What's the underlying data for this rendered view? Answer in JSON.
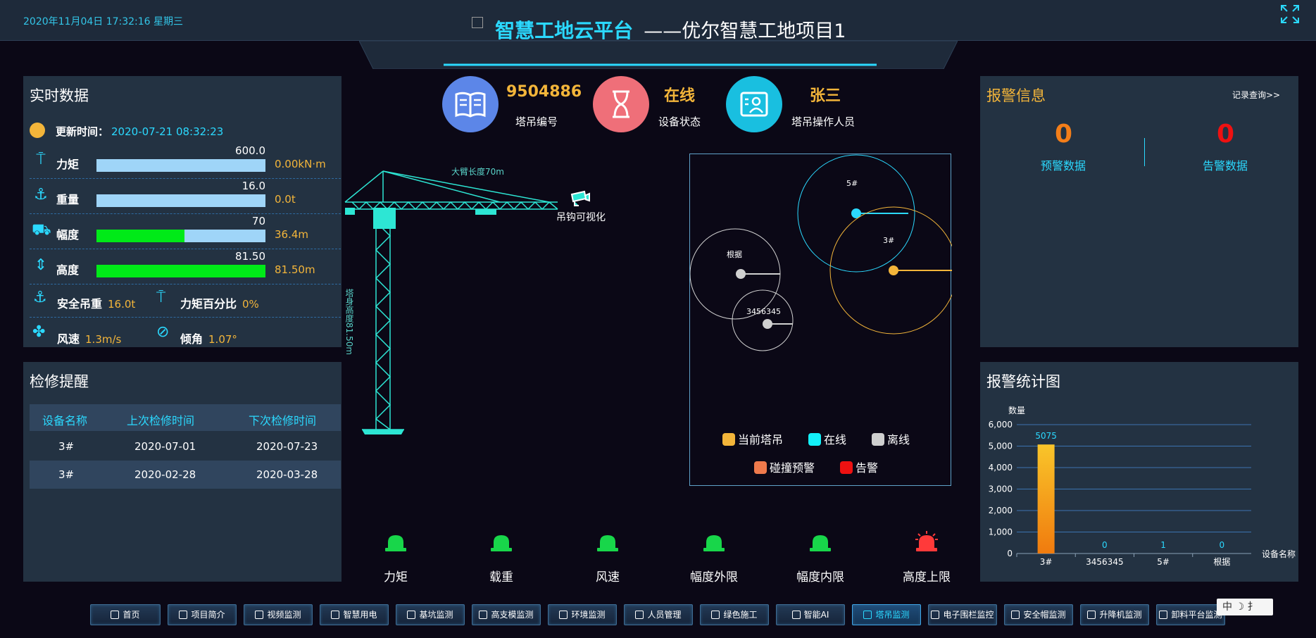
{
  "header": {
    "datetime": "2020年11月04日 17:32:16 星期三",
    "title_main": "智慧工地云平台",
    "title_sub": "——优尔智慧工地项目1"
  },
  "realtime": {
    "title": "实时数据",
    "update_label": "更新时间：",
    "update_time": "2020-07-21 08:32:23",
    "rows": [
      {
        "label": "力矩",
        "max": "600.0",
        "value": "0.00kN·m",
        "fill": 0.0,
        "icon": "crane-torque-icon"
      },
      {
        "label": "重量",
        "max": "16.0",
        "value": "0.0t",
        "fill": 0.0,
        "icon": "anchor-icon"
      },
      {
        "label": "幅度",
        "max": "70",
        "value": "36.4m",
        "fill": 0.52,
        "icon": "trolley-icon"
      },
      {
        "label": "高度",
        "max": "81.50",
        "value": "81.50m",
        "fill": 1.0,
        "icon": "height-icon"
      }
    ],
    "safe_load_label": "安全吊重",
    "safe_load_value": "16.0t",
    "torque_pct_label": "力矩百分比",
    "torque_pct_value": "0%",
    "wind_label": "风速",
    "wind_value": "1.3m/s",
    "tilt_label": "倾角",
    "tilt_value": "1.07°"
  },
  "maintenance": {
    "title": "检修提醒",
    "headers": [
      "设备名称",
      "上次检修时间",
      "下次检修时间"
    ],
    "rows": [
      [
        "3#",
        "2020-07-01",
        "2020-07-23"
      ],
      [
        "3#",
        "2020-02-28",
        "2020-03-28"
      ]
    ]
  },
  "stats": {
    "crane_id_value": "9504886",
    "crane_id_label": "塔吊编号",
    "status_value": "在线",
    "status_label": "设备状态",
    "operator_value": "张三",
    "operator_label": "塔吊操作人员"
  },
  "crane": {
    "arm_label": "大臂长度70m",
    "height_label": "塔身高度81.50m",
    "hook_label": "吊钩可视化"
  },
  "map": {
    "circles": [
      {
        "name": "5#",
        "color": "#2bd9ff"
      },
      {
        "name": "3#",
        "color": "#f3b53a"
      },
      {
        "name": "根据",
        "color": "#d0d0d0"
      },
      {
        "name": "3456345",
        "color": "#d0d0d0"
      }
    ],
    "legend": [
      {
        "label": "当前塔吊",
        "color": "#f3b53a"
      },
      {
        "label": "在线",
        "color": "#13f0f8"
      },
      {
        "label": "离线",
        "color": "#cfcfcf"
      },
      {
        "label": "碰撞预警",
        "color": "#ef7a4c"
      },
      {
        "label": "告警",
        "color": "#ee1111"
      }
    ]
  },
  "lights": [
    {
      "label": "力矩",
      "state": "green"
    },
    {
      "label": "载重",
      "state": "green"
    },
    {
      "label": "风速",
      "state": "green"
    },
    {
      "label": "幅度外限",
      "state": "green"
    },
    {
      "label": "幅度内限",
      "state": "green"
    },
    {
      "label": "高度上限",
      "state": "red"
    }
  ],
  "alarm": {
    "title": "报警信息",
    "record_link": "记录查询>>",
    "warning_value": "0",
    "warning_label": "预警数据",
    "alarm_value": "0",
    "alarm_label": "告警数据"
  },
  "alarm_chart_title": "报警统计图",
  "chart_data": {
    "type": "bar",
    "ylabel": "数量",
    "xlabel": "设备名称",
    "categories": [
      "3#",
      "3456345",
      "5#",
      "根据"
    ],
    "values": [
      5075,
      0,
      1,
      0
    ],
    "ylim": [
      0,
      6000
    ],
    "yticks": [
      "0",
      "1,000",
      "2,000",
      "3,000",
      "4,000",
      "5,000",
      "6,000"
    ],
    "bar_color": "#f3b53a",
    "grid": true
  },
  "nav": [
    {
      "label": "首页",
      "active": false
    },
    {
      "label": "项目简介",
      "active": false
    },
    {
      "label": "视频监测",
      "active": false
    },
    {
      "label": "智慧用电",
      "active": false
    },
    {
      "label": "基坑监测",
      "active": false
    },
    {
      "label": "高支模监测",
      "active": false
    },
    {
      "label": "环境监测",
      "active": false
    },
    {
      "label": "人员管理",
      "active": false
    },
    {
      "label": "绿色施工",
      "active": false
    },
    {
      "label": "智能AI",
      "active": false
    },
    {
      "label": "塔吊监测",
      "active": true
    },
    {
      "label": "电子围栏监控",
      "active": false
    },
    {
      "label": "安全帽监测",
      "active": false
    },
    {
      "label": "升降机监测",
      "active": false
    },
    {
      "label": "卸料平台监测",
      "active": false
    }
  ],
  "ime": "中 ☽ ⺘"
}
